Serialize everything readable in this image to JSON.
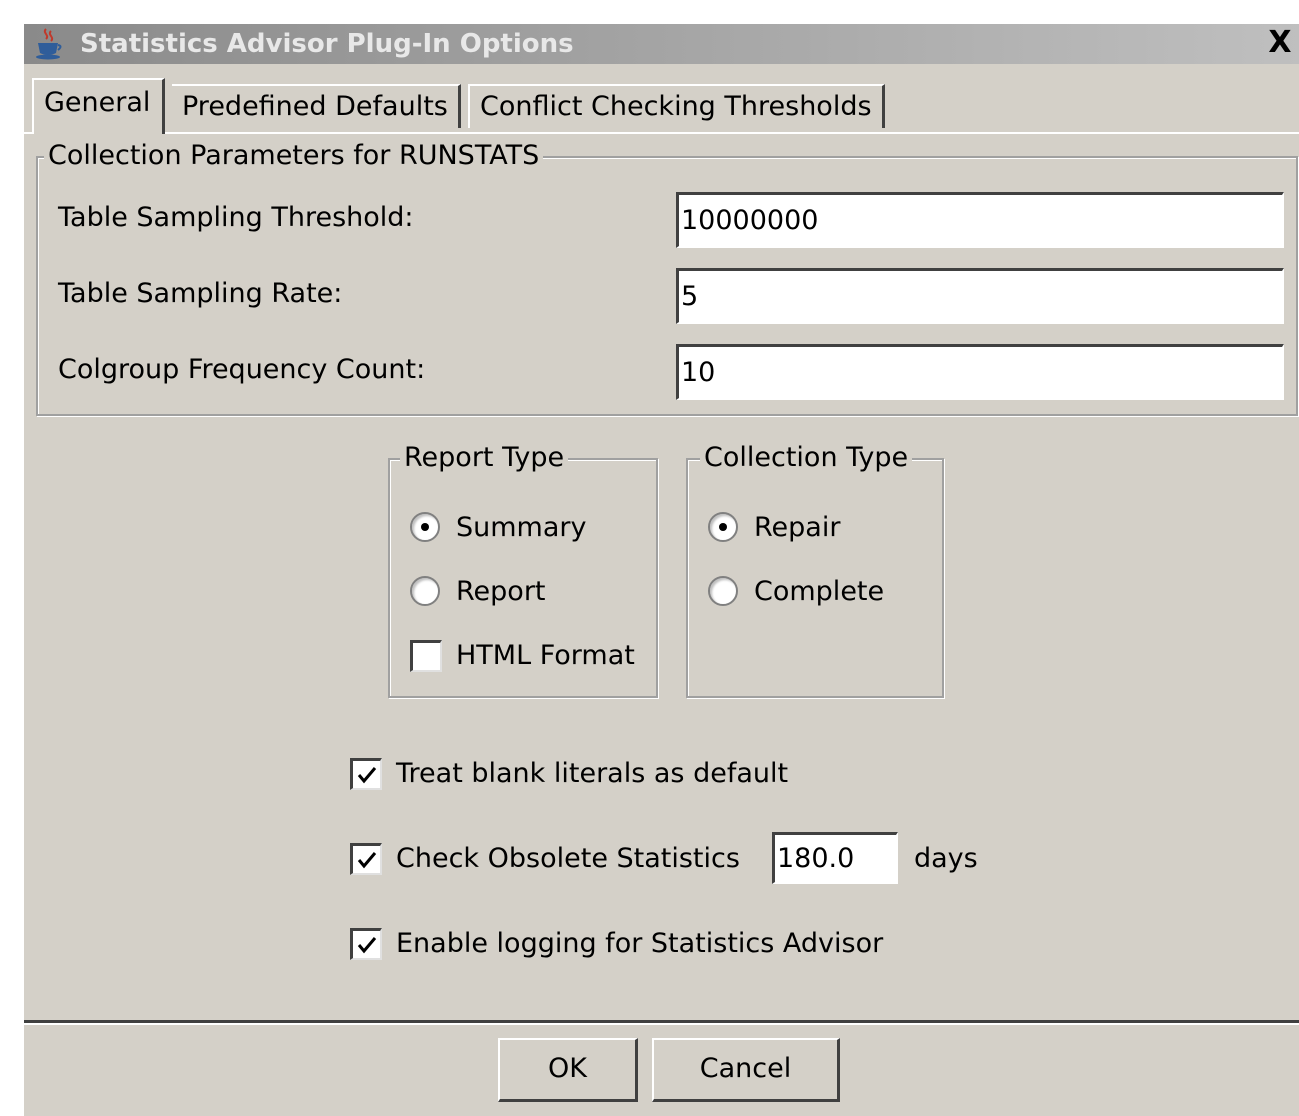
{
  "window": {
    "title": "Statistics Advisor Plug-In Options",
    "close_label": "X"
  },
  "tabs": [
    {
      "label": "General",
      "selected": true
    },
    {
      "label": "Predefined Defaults",
      "selected": false
    },
    {
      "label": "Conflict Checking Thresholds",
      "selected": false
    }
  ],
  "runstats": {
    "title": "Collection Parameters for RUNSTATS",
    "fields": [
      {
        "label": "Table Sampling Threshold:",
        "value": "10000000"
      },
      {
        "label": "Table Sampling Rate:",
        "value": "5"
      },
      {
        "label": "Colgroup Frequency Count:",
        "value": "10"
      }
    ]
  },
  "report_type": {
    "title": "Report Type",
    "options": [
      {
        "label": "Summary",
        "selected": true
      },
      {
        "label": "Report",
        "selected": false
      }
    ],
    "html_format": {
      "label": "HTML Format",
      "checked": false
    }
  },
  "collection_type": {
    "title": "Collection Type",
    "options": [
      {
        "label": "Repair",
        "selected": true
      },
      {
        "label": "Complete",
        "selected": false
      }
    ]
  },
  "options": {
    "treat_blank": {
      "label": "Treat blank literals as default",
      "checked": true
    },
    "check_obsolete": {
      "label": "Check Obsolete Statistics",
      "checked": true,
      "days_value": "180.0",
      "days_unit": "days"
    },
    "enable_logging": {
      "label": "Enable logging for Statistics Advisor",
      "checked": true
    }
  },
  "buttons": {
    "ok": "OK",
    "cancel": "Cancel"
  },
  "icons": {
    "title_icon": "java-cup-icon",
    "check_mark": "check-icon"
  }
}
